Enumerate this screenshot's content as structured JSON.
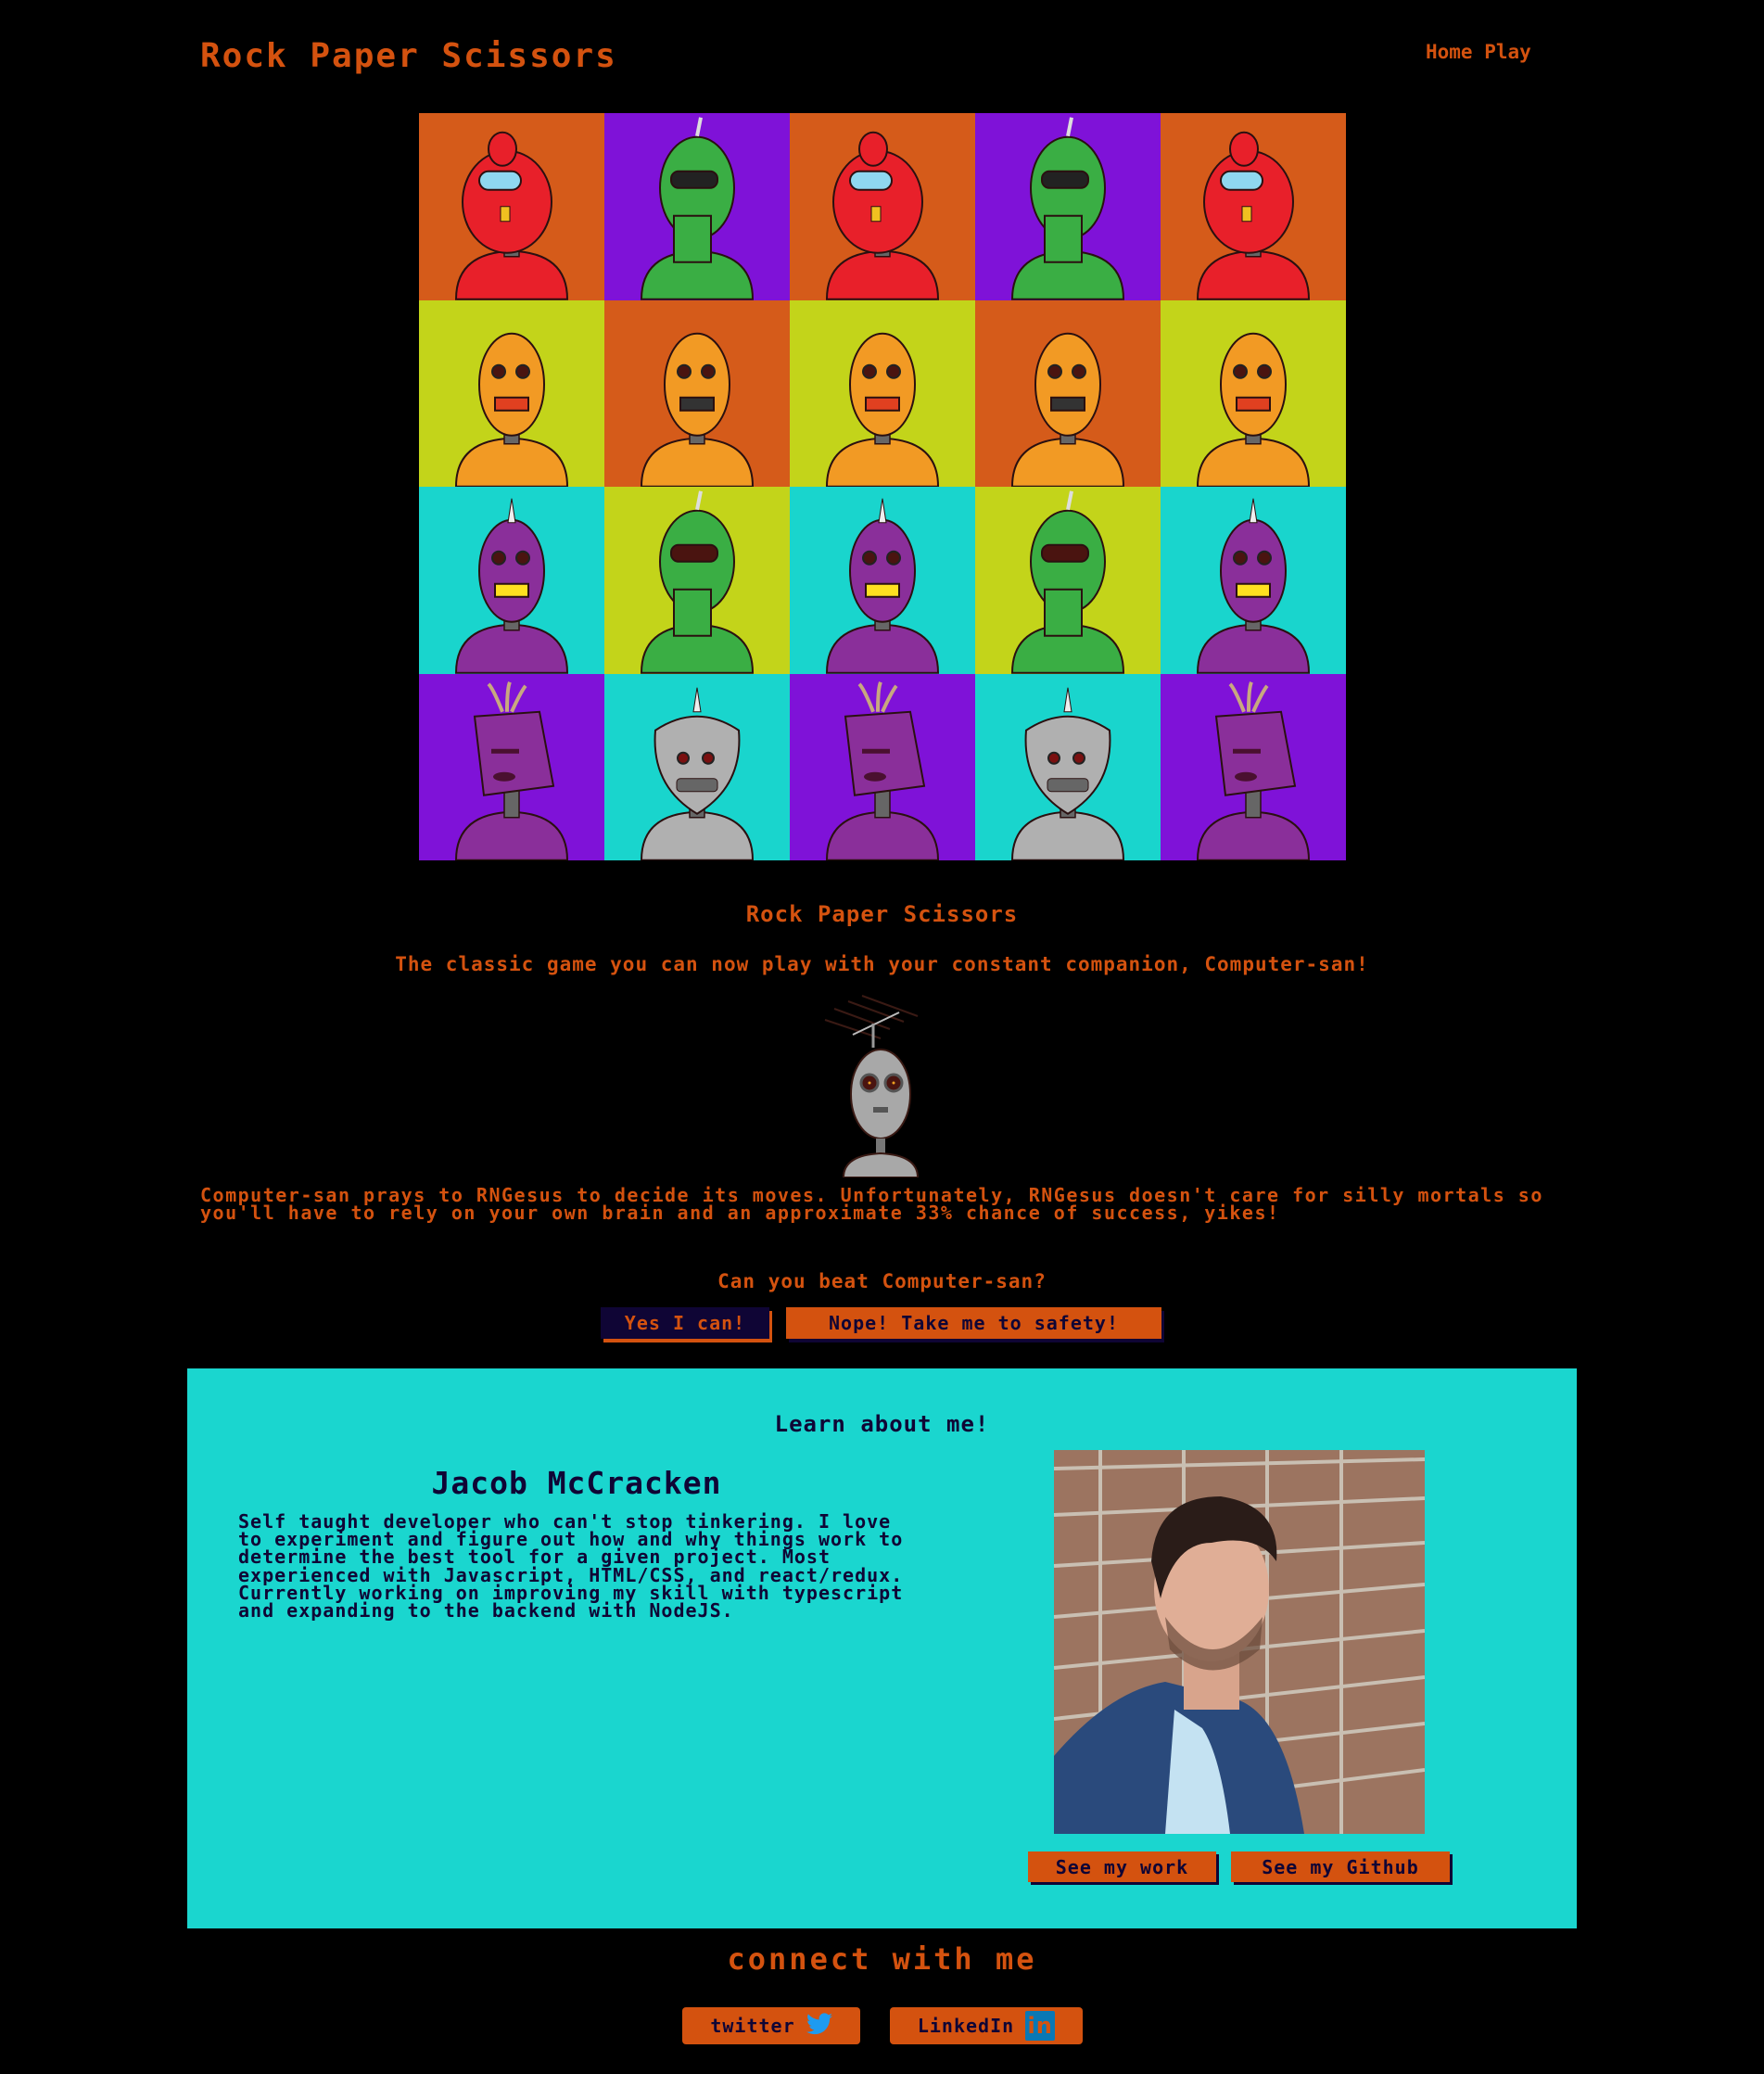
{
  "header": {
    "title": "Rock Paper Scissors",
    "nav": [
      {
        "label": "Home"
      },
      {
        "label": "Play"
      }
    ]
  },
  "colors": {
    "orange": "#d55b1a",
    "purple": "#7f12d8",
    "lime": "#c3d41a",
    "cyan": "#19d5cd",
    "accent_text": "#d4520f",
    "navy": "#0f0535"
  },
  "robot_grid": {
    "rows": [
      [
        {
          "bg": "orange",
          "robot": "red-dome-robot"
        },
        {
          "bg": "purple",
          "robot": "green-visor-robot"
        },
        {
          "bg": "orange",
          "robot": "red-dome-robot"
        },
        {
          "bg": "purple",
          "robot": "green-visor-robot"
        },
        {
          "bg": "orange",
          "robot": "red-dome-robot"
        }
      ],
      [
        {
          "bg": "lime",
          "robot": "orange-grill-robot"
        },
        {
          "bg": "orange",
          "robot": "orange-seven-robot"
        },
        {
          "bg": "lime",
          "robot": "orange-grill-robot"
        },
        {
          "bg": "orange",
          "robot": "orange-seven-robot"
        },
        {
          "bg": "lime",
          "robot": "orange-grill-robot"
        }
      ],
      [
        {
          "bg": "cyan",
          "robot": "purple-horn-robot"
        },
        {
          "bg": "lime",
          "robot": "green-dome-robot"
        },
        {
          "bg": "cyan",
          "robot": "purple-horn-robot"
        },
        {
          "bg": "lime",
          "robot": "green-dome-robot"
        },
        {
          "bg": "cyan",
          "robot": "purple-horn-robot"
        }
      ],
      [
        {
          "bg": "purple",
          "robot": "purple-tuft-robot"
        },
        {
          "bg": "cyan",
          "robot": "silver-horn-robot"
        },
        {
          "bg": "purple",
          "robot": "purple-tuft-robot"
        },
        {
          "bg": "cyan",
          "robot": "silver-horn-robot"
        },
        {
          "bg": "purple",
          "robot": "purple-tuft-robot"
        }
      ]
    ]
  },
  "intro": {
    "title": "Rock Paper Scissors",
    "tagline": "The classic game you can now play with your constant companion, Computer-san!",
    "description": "Computer-san prays to RNGesus to decide its moves. Unfortunately, RNGesus doesn't care for silly mortals so you'll have to rely on your own brain and an approximate 33% chance of success, yikes!",
    "question": "Can you beat Computer-san?",
    "yes_button": "Yes I can!",
    "no_button": "Nope! Take me to safety!"
  },
  "about": {
    "heading": "Learn about me!",
    "name": "Jacob McCracken",
    "bio": "Self taught developer who can't stop tinkering. I love to experiment and figure out how and why things work to determine the best tool for a given project. Most experienced with Javascript, HTML/CSS, and react/redux. Currently working on improving my skill with typescript and expanding to the backend with NodeJS.",
    "work_button": "See my work",
    "github_button": "See my Github"
  },
  "connect": {
    "heading": "connect with me",
    "twitter_label": "twitter",
    "linkedin_label": "LinkedIn",
    "linkedin_icon_text": "in"
  }
}
